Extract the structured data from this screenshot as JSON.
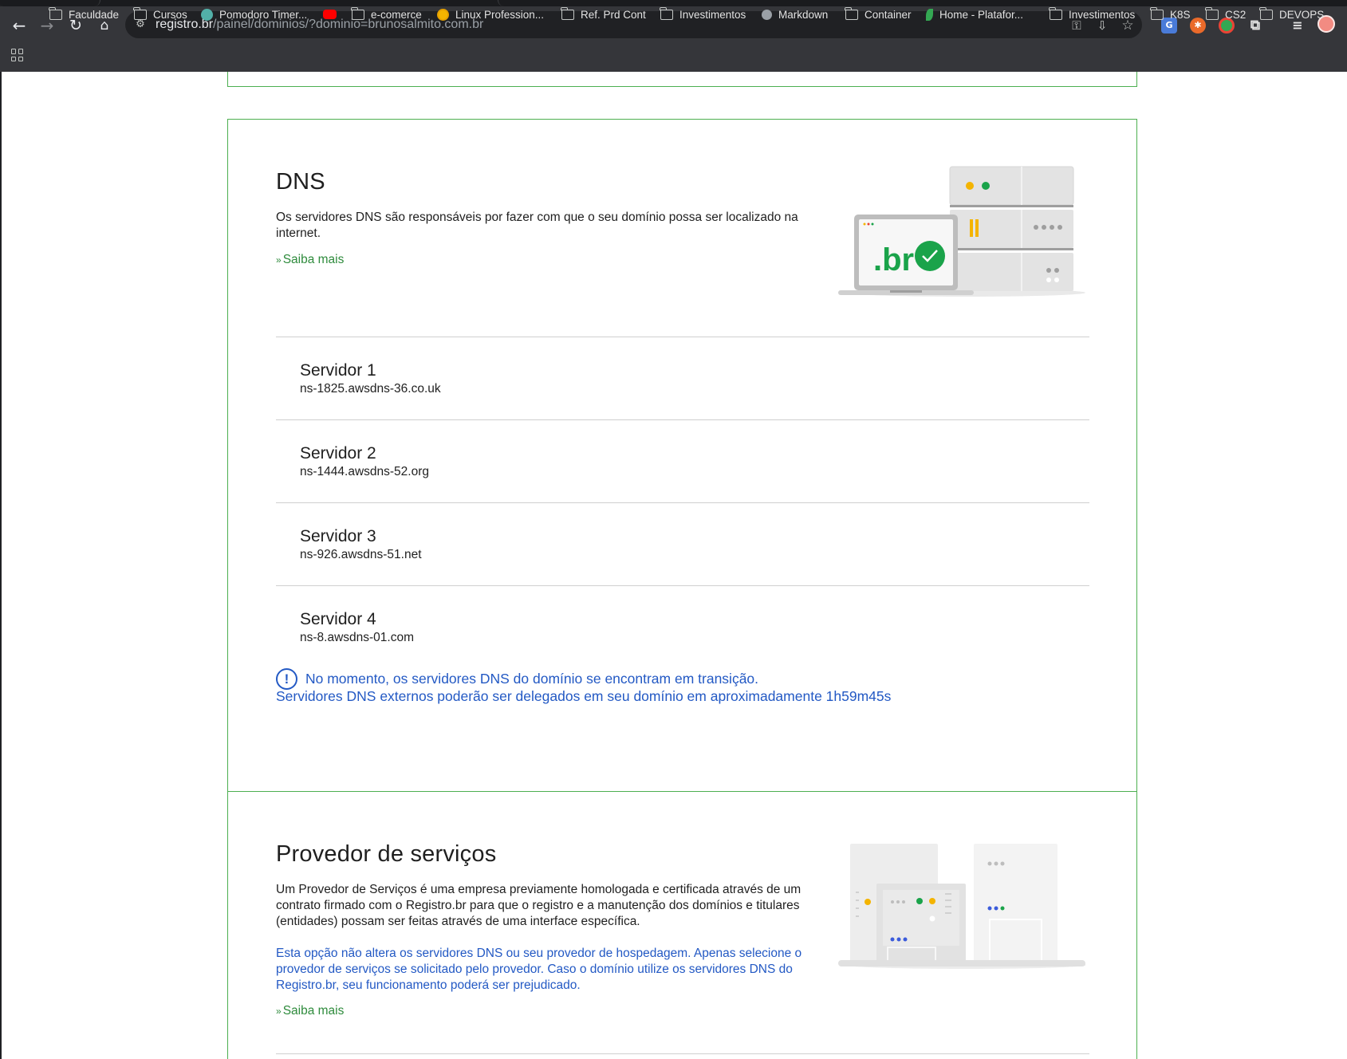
{
  "browser": {
    "url_host": "registro.br",
    "url_path": "/painel/dominios/?dominio=brunosalmito.com.br",
    "bookmarks": [
      {
        "label": "Faculdade",
        "icon": "folder-icon"
      },
      {
        "label": "Cursos",
        "icon": "folder-icon"
      },
      {
        "label": "Pomodoro Timer...",
        "icon": "pomodoro-check-icon"
      },
      {
        "label": "",
        "icon": "youtube-icon"
      },
      {
        "label": "e-comerce",
        "icon": "folder-icon"
      },
      {
        "label": "Linux Profession...",
        "icon": "linux-professional-icon"
      },
      {
        "label": "Ref. Prd Cont",
        "icon": "folder-icon"
      },
      {
        "label": "Investimentos",
        "icon": "folder-icon"
      },
      {
        "label": "Markdown",
        "icon": "markdown-icon"
      },
      {
        "label": "Container",
        "icon": "folder-icon"
      },
      {
        "label": "Home - Platafor...",
        "icon": "leaf-icon"
      },
      {
        "label": "Investimentos",
        "icon": "folder-icon"
      },
      {
        "label": "K8S",
        "icon": "folder-icon"
      },
      {
        "label": "CS2",
        "icon": "folder-icon"
      },
      {
        "label": "DEVOPS",
        "icon": "folder-icon"
      }
    ]
  },
  "dns": {
    "title": "DNS",
    "description": "Os servidores DNS são responsáveis por fazer com que o seu domínio possa ser localizado na internet.",
    "saiba_mais": "Saiba mais",
    "illustration_text": ".br",
    "servers": [
      {
        "label": "Servidor 1",
        "value": "ns-1825.awsdns-36.co.uk"
      },
      {
        "label": "Servidor 2",
        "value": "ns-1444.awsdns-52.org"
      },
      {
        "label": "Servidor 3",
        "value": "ns-926.awsdns-51.net"
      },
      {
        "label": "Servidor 4",
        "value": "ns-8.awsdns-01.com"
      }
    ],
    "alert_line1": "No momento, os servidores DNS do domínio se encontram em transição.",
    "alert_line2": "Servidores DNS externos poderão ser delegados em seu domínio em aproximadamente 1h59m45s",
    "alert_icon": "!"
  },
  "provider": {
    "title": "Provedor de serviços",
    "description": "Um Provedor de Serviços é uma empresa previamente homologada e certificada através de um contrato firmado com o Registro.br para que o registro e a manutenção dos domínios e titulares (entidades) possam ser feitas através de uma interface específica.",
    "note": "Esta opção não altera os servidores DNS ou seu provedor de hospedagem. Apenas selecione o provedor de serviços se solicitado pelo provedor. Caso o domínio utilize os servidores DNS do Registro.br, seu funcionamento poderá ser prejudicado.",
    "saiba_mais": "Saiba mais"
  },
  "colors": {
    "card_border": "#4caf50",
    "link_green": "#2e8b3c",
    "alert_blue": "#2359c4"
  }
}
